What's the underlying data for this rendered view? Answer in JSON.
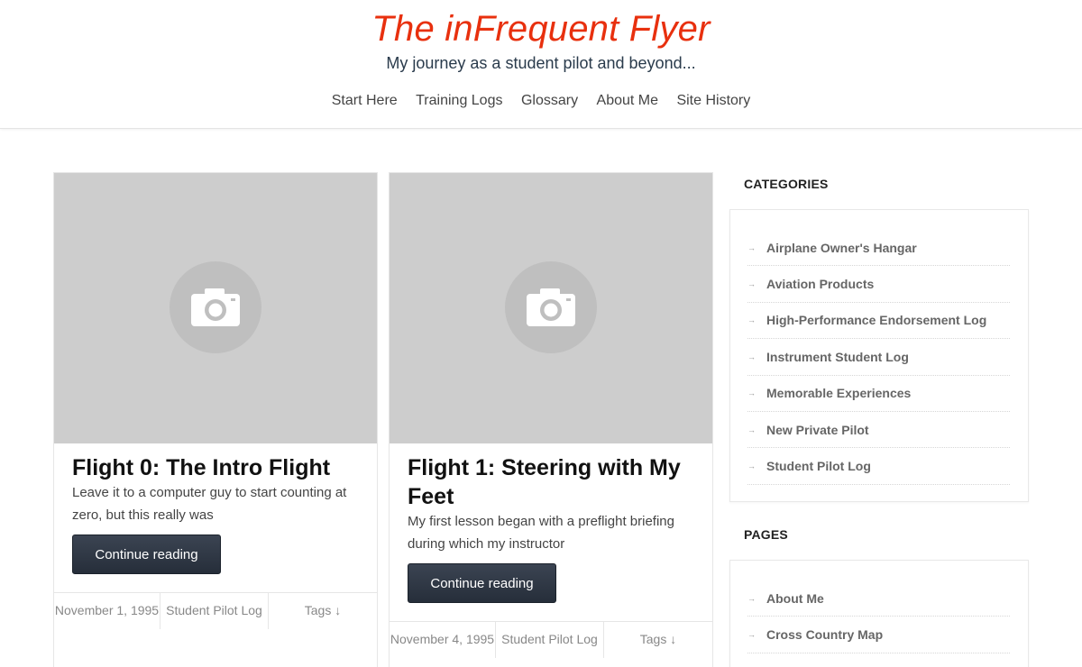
{
  "header": {
    "title": "The inFrequent Flyer",
    "tagline": "My journey as a student pilot and beyond..."
  },
  "nav": {
    "items": [
      "Start Here",
      "Training Logs",
      "Glossary",
      "About Me",
      "Site History"
    ]
  },
  "posts": [
    {
      "title": "Flight 0: The Intro Flight",
      "excerpt": "Leave it to a computer guy to start counting at zero, but this really was",
      "button": "Continue reading",
      "date": "November 1, 1995",
      "category": "Student Pilot Log",
      "tags": "Tags ↓"
    },
    {
      "title": "Flight 1: Steering with My Feet",
      "excerpt": "My first lesson began with a preflight briefing during which my instructor",
      "button": "Continue reading",
      "date": "November 4, 1995",
      "category": "Student Pilot Log",
      "tags": "Tags ↓"
    }
  ],
  "sidebar": {
    "categories_title": "CATEGORIES",
    "categories": [
      "Airplane Owner's Hangar",
      "Aviation Products",
      "High-Performance Endorsement Log",
      "Instrument Student Log",
      "Memorable Experiences",
      "New Private Pilot",
      "Student Pilot Log"
    ],
    "pages_title": "PAGES",
    "pages": [
      "About Me",
      "Cross Country Map"
    ]
  },
  "icons": {
    "thumbnail": "camera-icon",
    "list_bullet": "arrow-right-icon"
  },
  "colors": {
    "title_red": "#e8300e",
    "tagline_navy": "#2a3b4c",
    "button_dark": "#2f3845"
  }
}
